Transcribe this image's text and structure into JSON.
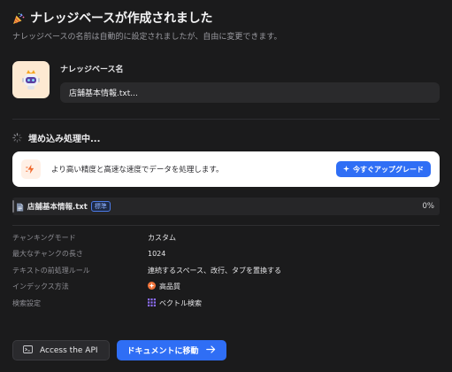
{
  "header": {
    "title": "ナレッジベースが作成されました",
    "subtitle": "ナレッジベースの名前は自動的に設定されましたが、自由に変更できます。"
  },
  "knowledge_base": {
    "name_label": "ナレッジベース名",
    "name_value": "店舗基本情報.txt..."
  },
  "embedding": {
    "title": "埋め込み処理中..."
  },
  "upgrade": {
    "text": "より高い精度と高速な速度でデータを処理します。",
    "button_label": "今すぐアップグレード"
  },
  "file": {
    "name": "店舗基本情報.txt",
    "tag": "標準",
    "progress": "0%"
  },
  "settings": [
    {
      "key": "チャンキングモード",
      "value": "カスタム",
      "icon": ""
    },
    {
      "key": "最大なチャンクの長さ",
      "value": "1024",
      "icon": ""
    },
    {
      "key": "テキストの前処理ルール",
      "value": "連続するスペース、改行、タブを置換する",
      "icon": ""
    },
    {
      "key": "インデックス方法",
      "value": "高品質",
      "icon": "high-quality-icon"
    },
    {
      "key": "検索設定",
      "value": "ベクトル検索",
      "icon": "vector-search-icon"
    }
  ],
  "footer": {
    "api_button": "Access the API",
    "docs_button": "ドキュメントに移動"
  },
  "colors": {
    "background": "#1b1b1c",
    "accent": "#2f6ef5",
    "card": "#ffffff",
    "quality_orange": "#f0743b",
    "vector_purple": "#8b6cf6"
  }
}
